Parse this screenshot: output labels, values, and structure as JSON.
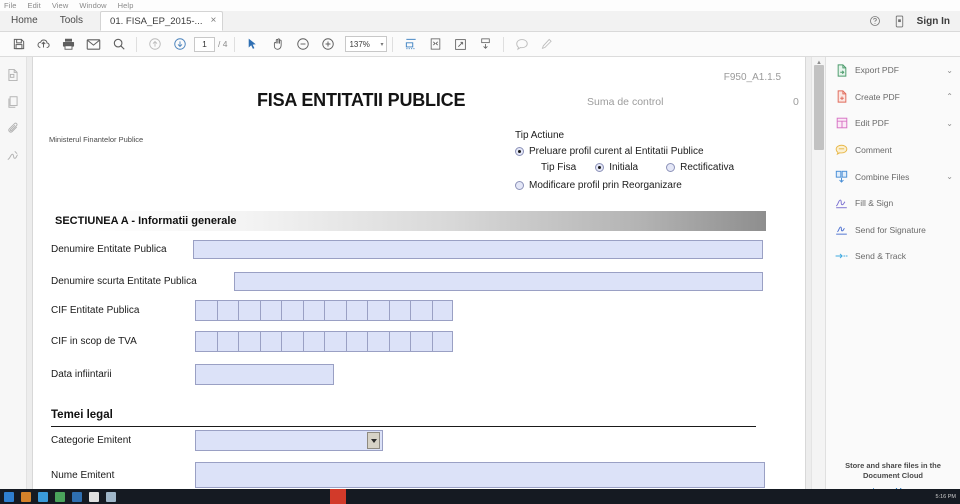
{
  "window": {
    "menu": [
      "File",
      "Edit",
      "View",
      "Window",
      "Help"
    ],
    "tabs": {
      "home": "Home",
      "tools": "Tools",
      "document": "01. FISA_EP_2015-...",
      "close": "×"
    },
    "sign_in": "Sign In",
    "help_icon": "help-circle-icon",
    "mobile_icon": "mobile-device-icon"
  },
  "toolbar": {
    "save_icon": "save-icon",
    "upload_icon": "cloud-upload-icon",
    "print_icon": "print-icon",
    "email_icon": "email-icon",
    "search_icon": "search-icon",
    "prev_page_icon": "arrow-up-circle-icon",
    "next_page_icon": "arrow-down-circle-icon",
    "page_current": "1",
    "page_total": "/ 4",
    "select_icon": "cursor-select-icon",
    "hand_icon": "hand-pan-icon",
    "zoom_out_icon": "zoom-out-icon",
    "zoom_in_icon": "zoom-in-icon",
    "zoom_level": "137%",
    "zoom_caret": "▾",
    "fit_width_icon": "fit-width-icon",
    "fit_page_icon": "fit-page-icon",
    "fullscreen_icon": "fullscreen-icon",
    "scroll_mode_icon": "scroll-mode-icon",
    "comment_icon": "comment-bubble-icon",
    "highlight_icon": "highlight-pen-icon"
  },
  "left_rail": [
    {
      "icon": "page-thumbnails-icon"
    },
    {
      "icon": "pages-copy-icon"
    },
    {
      "icon": "paperclip-attachment-icon"
    },
    {
      "icon": "signature-icon"
    }
  ],
  "right_panel": {
    "items": [
      {
        "label": "Export PDF",
        "icon": "export-pdf-icon",
        "chevron": "⌄",
        "color": "#4a9a6a"
      },
      {
        "label": "Create PDF",
        "icon": "create-pdf-icon",
        "chevron": "⌃",
        "color": "#e06a5a"
      },
      {
        "label": "Edit PDF",
        "icon": "edit-pdf-icon",
        "chevron": "⌄",
        "color": "#d773c4"
      },
      {
        "label": "Comment",
        "icon": "comment-icon",
        "chevron": "",
        "color": "#e8b84a"
      },
      {
        "label": "Combine Files",
        "icon": "combine-files-icon",
        "chevron": "⌄",
        "color": "#4a8fd6"
      },
      {
        "label": "Fill & Sign",
        "icon": "fill-sign-icon",
        "chevron": "",
        "color": "#7a6fd0"
      },
      {
        "label": "Send for Signature",
        "icon": "send-for-signature-icon",
        "chevron": "",
        "color": "#4a6fd0"
      },
      {
        "label": "Send & Track",
        "icon": "send-track-icon",
        "chevron": "",
        "color": "#3fa9e0"
      }
    ],
    "footer_line1": "Store and share files in the",
    "footer_line2": "Document Cloud",
    "footer_link": "Learn More"
  },
  "document": {
    "form_code": "F950_A1.1.5",
    "title": "FISA ENTITATII PUBLICE",
    "suma_label": "Suma de control",
    "suma_value": "0",
    "ministry": "Ministerul Finantelor Publice",
    "tip_actiune": {
      "heading": "Tip Actiune",
      "option_preluare": "Preluare profil curent al Entitatii Publice",
      "tip_fisa_label": "Tip Fisa",
      "option_initiala": "Initiala",
      "option_rectificativa": "Rectificativa",
      "option_modificare": "Modificare profil prin Reorganizare"
    },
    "section_a": {
      "header": "SECTIUNEA A - Informatii generale",
      "fields": {
        "denumire_entitate": {
          "label": "Denumire Entitate Publica",
          "value": ""
        },
        "denumire_scurta": {
          "label": "Denumire scurta Entitate Publica",
          "value": ""
        },
        "cif_entitate": {
          "label": "CIF Entitate Publica",
          "cells": 12
        },
        "cif_tva": {
          "label": "CIF in scop de TVA",
          "cells": 12
        },
        "data_infiintarii": {
          "label": "Data infiintarii",
          "value": ""
        }
      }
    },
    "temei_legal": {
      "header": "Temei legal",
      "categorie_emitent": {
        "label": "Categorie Emitent",
        "value": ""
      },
      "nume_emitent": {
        "label": "Nume Emitent",
        "value": ""
      }
    }
  },
  "taskbar": {
    "clock": "5:16 PM"
  }
}
